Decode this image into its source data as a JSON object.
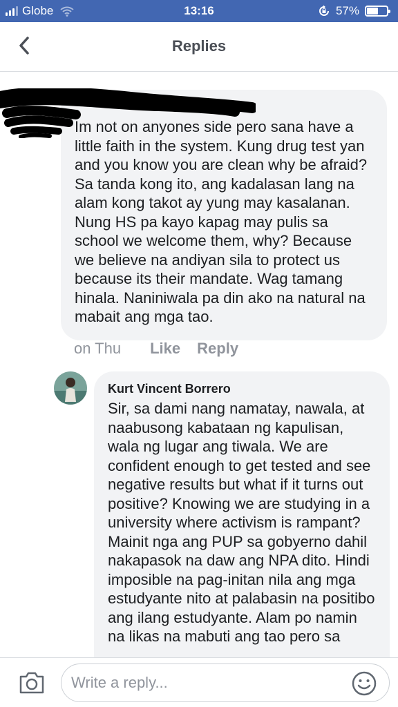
{
  "status_bar": {
    "carrier": "Globe",
    "time": "13:16",
    "battery_percent": "57%",
    "battery_level": 0.57
  },
  "header": {
    "title": "Replies",
    "back_icon": "chevron-left-icon"
  },
  "comment": {
    "text": "Im not on anyones side pero sana have a little faith in the system. Kung drug test yan and you know you are clean why be afraid? Sa tanda kong ito, ang kadalasan lang na alam kong takot ay yung may kasalanan. Nung HS pa kayo kapag may pulis sa school we welcome them, why? Because we believe na andiyan sila to protect us because its their mandate. Wag tamang hinala. Naniniwala pa din ako na natural na mabait ang mga tao.",
    "time": "on Thu",
    "like_label": "Like",
    "reply_label": "Reply"
  },
  "reply": {
    "author": "Kurt Vincent Borrero",
    "text": "Sir, sa dami nang namatay, nawala, at naabusong kabataan ng kapulisan, wala ng lugar ang tiwala. We are confident enough to get tested and see negative results but what if it turns out positive? Knowing we are studying in a university where activism is rampant? Mainit nga ang PUP sa gobyerno dahil nakapasok na daw ang NPA dito. Hindi imposible na pag-initan nila ang mga estudyante nito at palabasin na positibo ang ilang estudyante. Alam po namin na likas na mabuti ang tao pero sa"
  },
  "composer": {
    "placeholder": "Write a reply...",
    "camera_icon": "camera-icon",
    "emoji_icon": "smiley-icon"
  },
  "colors": {
    "status_bar": "#4267b2",
    "bubble": "#f2f3f5",
    "secondary_text": "#90949c"
  }
}
